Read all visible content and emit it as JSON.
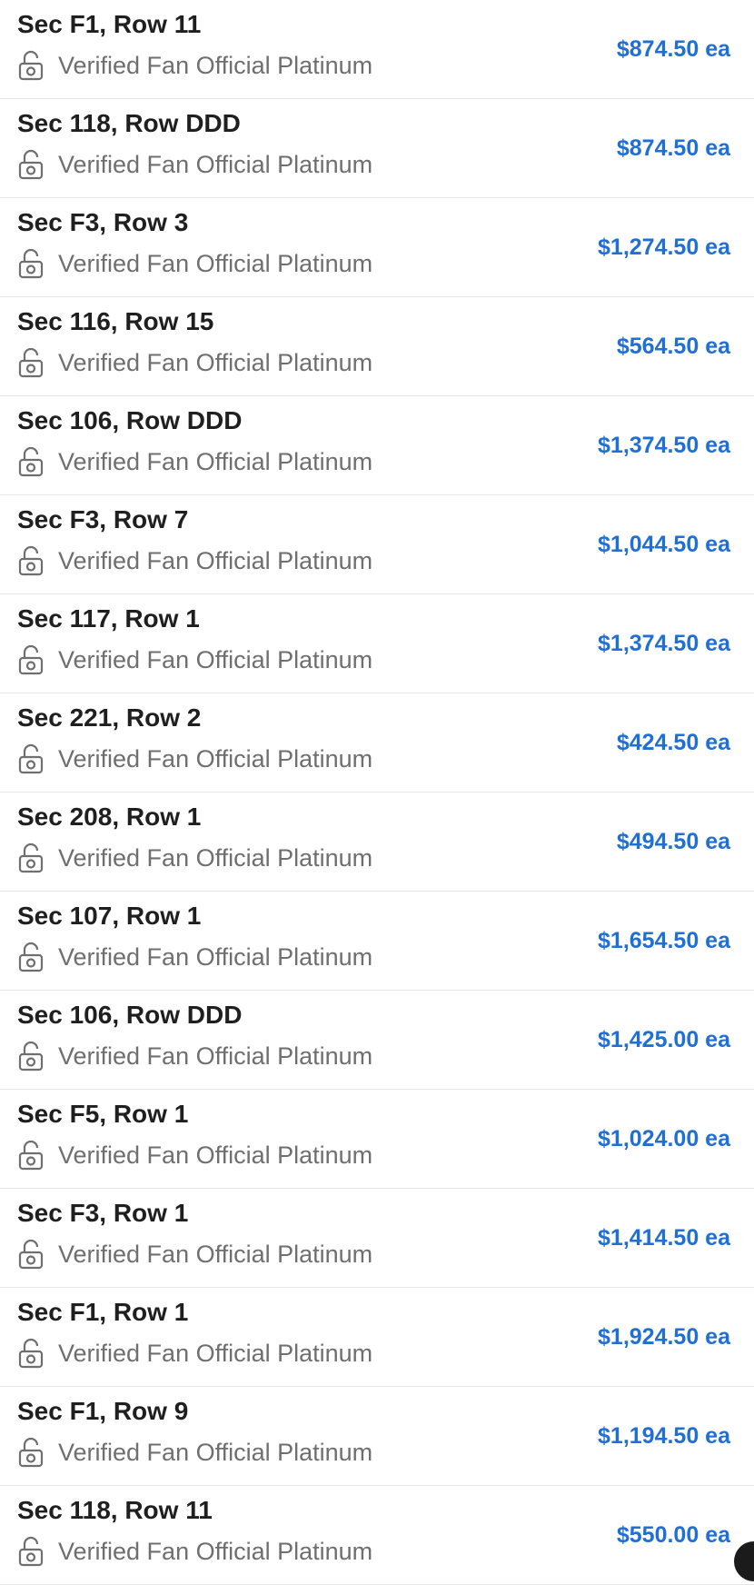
{
  "colors": {
    "price": "#1f6fd6",
    "title": "#1f1f1f",
    "tag": "#6f6f6f",
    "divider": "#e6e6e6"
  },
  "icons": {
    "tag_icon": "lock-icon"
  },
  "listings": [
    {
      "section_row": "Sec F1, Row 11",
      "ticket_type": "Verified Fan Official Platinum",
      "price": "$874.50 ea"
    },
    {
      "section_row": "Sec 118, Row DDD",
      "ticket_type": "Verified Fan Official Platinum",
      "price": "$874.50 ea"
    },
    {
      "section_row": "Sec F3, Row 3",
      "ticket_type": "Verified Fan Official Platinum",
      "price": "$1,274.50 ea"
    },
    {
      "section_row": "Sec 116, Row 15",
      "ticket_type": "Verified Fan Official Platinum",
      "price": "$564.50 ea"
    },
    {
      "section_row": "Sec 106, Row DDD",
      "ticket_type": "Verified Fan Official Platinum",
      "price": "$1,374.50 ea"
    },
    {
      "section_row": "Sec F3, Row 7",
      "ticket_type": "Verified Fan Official Platinum",
      "price": "$1,044.50 ea"
    },
    {
      "section_row": "Sec 117, Row 1",
      "ticket_type": "Verified Fan Official Platinum",
      "price": "$1,374.50 ea"
    },
    {
      "section_row": "Sec 221, Row 2",
      "ticket_type": "Verified Fan Official Platinum",
      "price": "$424.50 ea"
    },
    {
      "section_row": "Sec 208, Row 1",
      "ticket_type": "Verified Fan Official Platinum",
      "price": "$494.50 ea"
    },
    {
      "section_row": "Sec 107, Row 1",
      "ticket_type": "Verified Fan Official Platinum",
      "price": "$1,654.50 ea"
    },
    {
      "section_row": "Sec 106, Row DDD",
      "ticket_type": "Verified Fan Official Platinum",
      "price": "$1,425.00 ea"
    },
    {
      "section_row": "Sec F5, Row 1",
      "ticket_type": "Verified Fan Official Platinum",
      "price": "$1,024.00 ea"
    },
    {
      "section_row": "Sec F3, Row 1",
      "ticket_type": "Verified Fan Official Platinum",
      "price": "$1,414.50 ea"
    },
    {
      "section_row": "Sec F1, Row 1",
      "ticket_type": "Verified Fan Official Platinum",
      "price": "$1,924.50 ea"
    },
    {
      "section_row": "Sec F1, Row 9",
      "ticket_type": "Verified Fan Official Platinum",
      "price": "$1,194.50 ea"
    },
    {
      "section_row": "Sec 118, Row 11",
      "ticket_type": "Verified Fan Official Platinum",
      "price": "$550.00 ea"
    }
  ]
}
